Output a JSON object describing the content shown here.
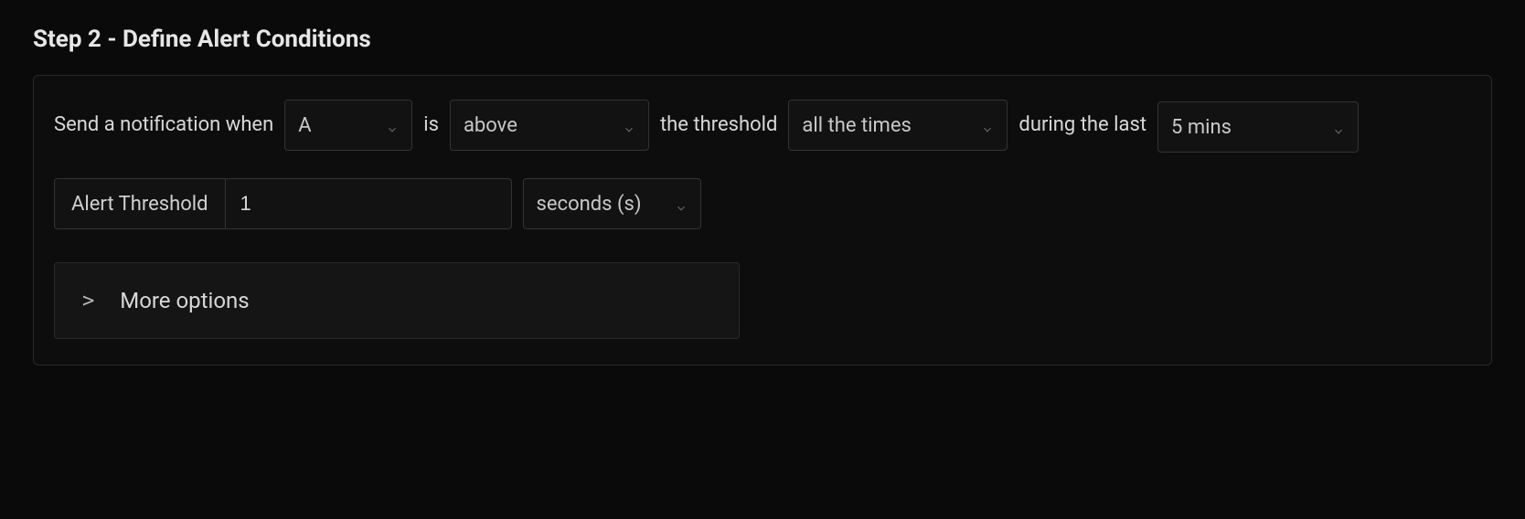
{
  "step": {
    "title": "Step 2 - Define Alert Conditions"
  },
  "condition": {
    "prefix": "Send a notification when",
    "metric_value": "A",
    "is_label": "is",
    "comparison_value": "above",
    "threshold_label": "the threshold",
    "frequency_value": "all the times",
    "during_label": "during the last",
    "window_value": "5 mins"
  },
  "threshold": {
    "label": "Alert Threshold",
    "value": "1",
    "unit_value": "seconds (s)"
  },
  "more": {
    "label": "More options",
    "chevron": ">"
  }
}
